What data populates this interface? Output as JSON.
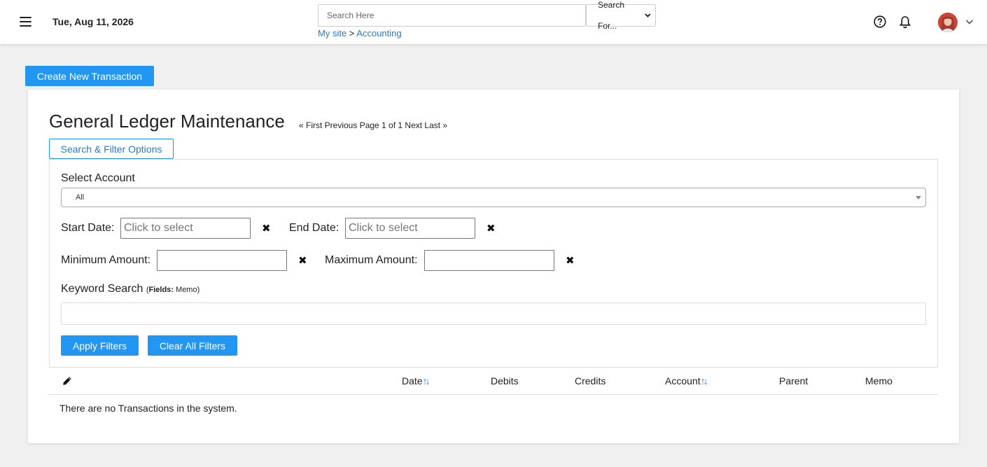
{
  "header": {
    "date": "Tue, Aug 11, 2026",
    "search_placeholder": "Search Here",
    "search_for_label": "Search For...",
    "breadcrumb": {
      "site": "My site",
      "separator": ">",
      "current": "Accounting"
    },
    "icons": [
      "menu-icon",
      "help-icon",
      "bell-icon",
      "avatar",
      "chevron-down-icon"
    ]
  },
  "actions": {
    "create_label": "Create New Transaction"
  },
  "main": {
    "title": "General Ledger Maintenance",
    "pager": "« First Previous Page 1 of 1 Next Last »",
    "filter_toggle_label": "Search & Filter Options"
  },
  "filters": {
    "select_account_label": "Select Account",
    "account_value": "All",
    "start_date_label": "Start Date:",
    "end_date_label": "End Date:",
    "date_placeholder": "Click to select",
    "min_amount_label": "Minimum Amount:",
    "max_amount_label": "Maximum Amount:",
    "clear_glyph": "✖",
    "keyword_label": "Keyword Search",
    "keyword_fields_prefix": "Fields:",
    "keyword_fields": "Memo",
    "apply_label": "Apply Filters",
    "clear_all_label": "Clear All Filters"
  },
  "table": {
    "columns": [
      "Date",
      "Debits",
      "Credits",
      "Account",
      "Parent",
      "Memo"
    ],
    "sort_glyph": "↑↓",
    "empty_message": "There are no Transactions in the system."
  },
  "colors": {
    "accent": "#2196f3",
    "link": "#1f7bd3",
    "background": "#f0f0f0"
  }
}
